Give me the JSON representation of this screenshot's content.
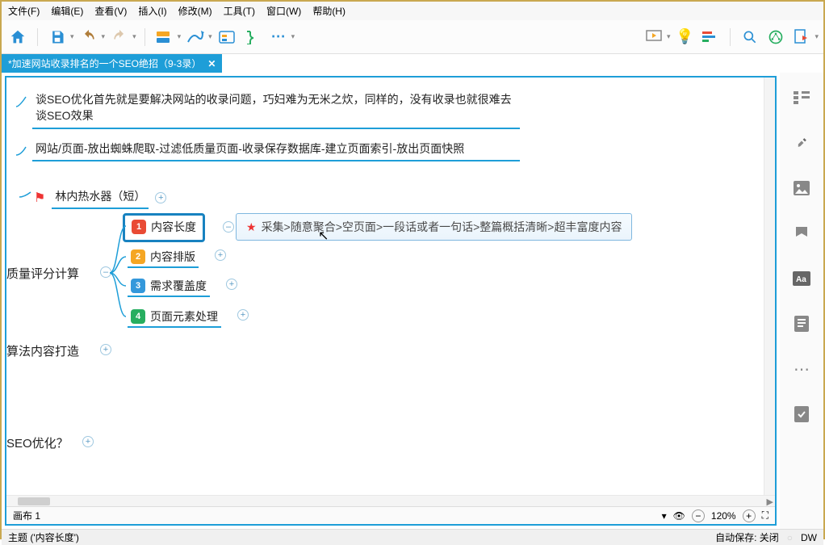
{
  "menu": {
    "file": "文件(F)",
    "edit": "编辑(E)",
    "view": "查看(V)",
    "insert": "插入(I)",
    "modify": "修改(M)",
    "tools": "工具(T)",
    "window": "窗口(W)",
    "help": "帮助(H)"
  },
  "tab": {
    "title": "*加速网站收录排名的一个SEO绝招（9-3录）",
    "close": "✕"
  },
  "nodes": {
    "a": "谈SEO优化首先就是要解决网站的收录问题，巧妇难为无米之炊，同样的，没有收录也就很难去谈SEO效果",
    "b": "网站/页面-放出蜘蛛爬取-过滤低质量页面-收录保存数据库-建立页面索引-放出页面快照",
    "c": "林内热水器（短）",
    "quality": "质量评分计算",
    "s1": "内容长度",
    "s2": "内容排版",
    "s3": "需求覆盖度",
    "s4": "页面元素处理",
    "d": "算法内容打造",
    "e": "SEO优化？",
    "callout": "采集>随意聚合>空页面>一段话或者一句话>整篇概括清晰>超丰富度内容"
  },
  "bottom": {
    "canvas": "画布 1",
    "zoom": "120%"
  },
  "status": {
    "topic": "主题 ('内容长度')",
    "autosave": "自动保存: 关闭",
    "dw": "DW"
  }
}
